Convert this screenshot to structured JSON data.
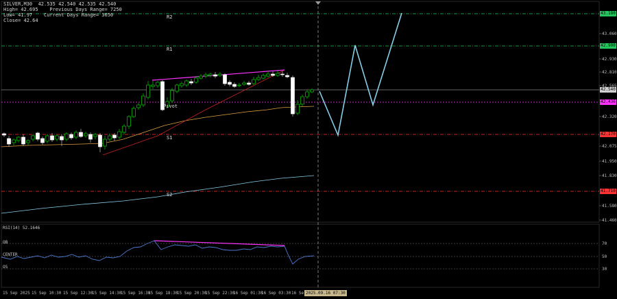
{
  "info": {
    "line1": "SILVER,M30  42.535 42.540 42.535 42.540",
    "line2": "High= 42.695    Previous Days Range= 7250",
    "line3": "Low= 41.97    Current Days Range= 3650",
    "line4": "Close= 42.64"
  },
  "levels": {
    "r2": {
      "label": "R2",
      "price": "43.180",
      "color": "#22c55e"
    },
    "r1": {
      "label": "R1",
      "price": "42.900",
      "color": "#22c55e"
    },
    "current": {
      "price": "42.540",
      "color": "#d0d0d0"
    },
    "pivot": {
      "label": "Pivot",
      "price": "42.436",
      "color": "#ff33ff"
    },
    "s1": {
      "label": "S1",
      "price": "42.170",
      "color": "#ff3333"
    },
    "s2": {
      "label": "S2",
      "price": "41.710",
      "color": "#ff3333"
    }
  },
  "price_ticks": [
    "43.060",
    "42.930",
    "42.810",
    "42.565",
    "42.320",
    "42.075",
    "41.950",
    "41.830",
    "41.580",
    "41.460"
  ],
  "time_ticks": [
    "15 Sep 2025",
    "15 Sep 10:30",
    "15 Sep 12:30",
    "15 Sep 14:30",
    "15 Sep 16:30",
    "15 Sep 18:30",
    "15 Sep 20:30",
    "15 Sep 22:30",
    "16 Sep 01:30",
    "16 Sep 03:30",
    "16 Se"
  ],
  "cursor_time": "2025.09.16 07:30",
  "rsi": {
    "title": "RSI(14) 52.1646",
    "ob": "OB",
    "center": "CENTER",
    "os": "OS",
    "ticks": [
      "70",
      "50",
      "30"
    ]
  },
  "colors": {
    "bull": "#00cc00",
    "bear": "#ffffff",
    "ma_slow": "#87ceeb",
    "ma_fast": "#e0a040",
    "divergence": "#ff33ff",
    "trend": "#cc2222",
    "projection": "#87ceeb",
    "rsi_line": "#4a78d0"
  }
}
